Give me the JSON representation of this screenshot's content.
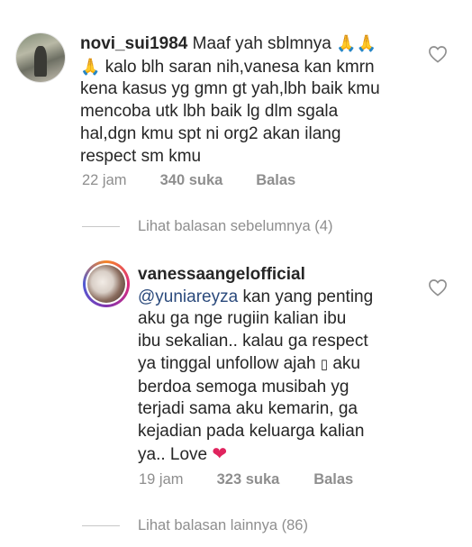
{
  "comments": [
    {
      "username": "novi_sui1984",
      "text_line1": "Maaf yah sblmnya",
      "text_line1_emoji": "🙏🙏",
      "text_line2_emoji": "🙏",
      "text_line2": "kalo blh saran nih,vanesa kan kmrn",
      "text_line3": "kena kasus yg gmn gt yah,lbh baik kmu",
      "text_line4": "mencoba utk lbh baik lg dlm sgala",
      "text_line5": "hal,dgn kmu spt ni org2 akan ilang",
      "text_line6": "respect sm kmu",
      "time": "22 jam",
      "likes": "340 suka",
      "reply_label": "Balas"
    },
    {
      "username": "vanessaangelofficial",
      "mention": "@yuniareyza",
      "text_line1": "kan yang penting",
      "text_line2": "aku ga nge rugiin kalian ibu",
      "text_line3": "ibu sekalian.. kalau ga respect",
      "text_line4_pre": "ya tinggal unfollow ajah",
      "text_line4_glyph": "▯",
      "text_line4_post": "aku",
      "text_line5": "berdoa semoga musibah yg",
      "text_line6": "terjadi sama aku kemarin, ga",
      "text_line7": "kejadian pada keluarga kalian",
      "text_line8": "ya.. Love",
      "emoji_heart": "❤",
      "time": "19 jam",
      "likes": "323 suka",
      "reply_label": "Balas"
    }
  ],
  "view_previous": "Lihat balasan sebelumnya (4)",
  "view_more": "Lihat balasan lainnya (86)",
  "icons": {
    "like": "heart-outline-icon"
  },
  "colors": {
    "text": "#262626",
    "muted": "#8e8e8e",
    "mention": "#2b4a7c",
    "heart": "#e0245e"
  }
}
